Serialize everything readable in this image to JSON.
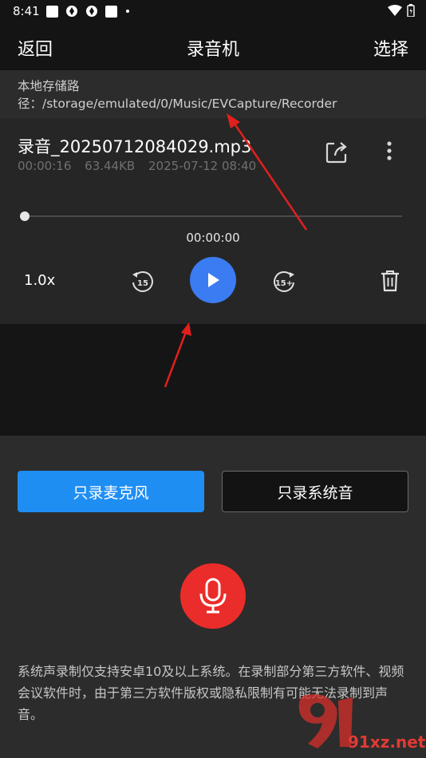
{
  "status_bar": {
    "time": "8:41"
  },
  "top_bar": {
    "back_label": "返回",
    "title": "录音机",
    "select_label": "选择"
  },
  "storage_path": {
    "text": "本地存储路径：/storage/emulated/0/Music/EVCapture/Recorder"
  },
  "recording": {
    "file_name": "录音_20250712084029.mp3",
    "duration": "00:00:16",
    "size": "63.44KB",
    "date": "2025-07-12 08:40",
    "current_time": "00:00:00",
    "progress": 0,
    "speed": "1.0x",
    "rewind_label": "15",
    "forward_label": "15+"
  },
  "mode_buttons": {
    "mic_only": "只录麦克风",
    "system_only": "只录系统音"
  },
  "notice": "系统声录制仅支持安卓10及以上系统。在录制部分第三方软件、视频会议软件时，由于第三方软件版权或隐私限制有可能无法录制到声音。",
  "watermark": {
    "text": "91xz.net"
  },
  "colors": {
    "accent_blue": "#3b7cf2",
    "button_blue": "#1f8ef3",
    "record_red": "#ea2d2a",
    "annotation_red": "#e0201e"
  }
}
